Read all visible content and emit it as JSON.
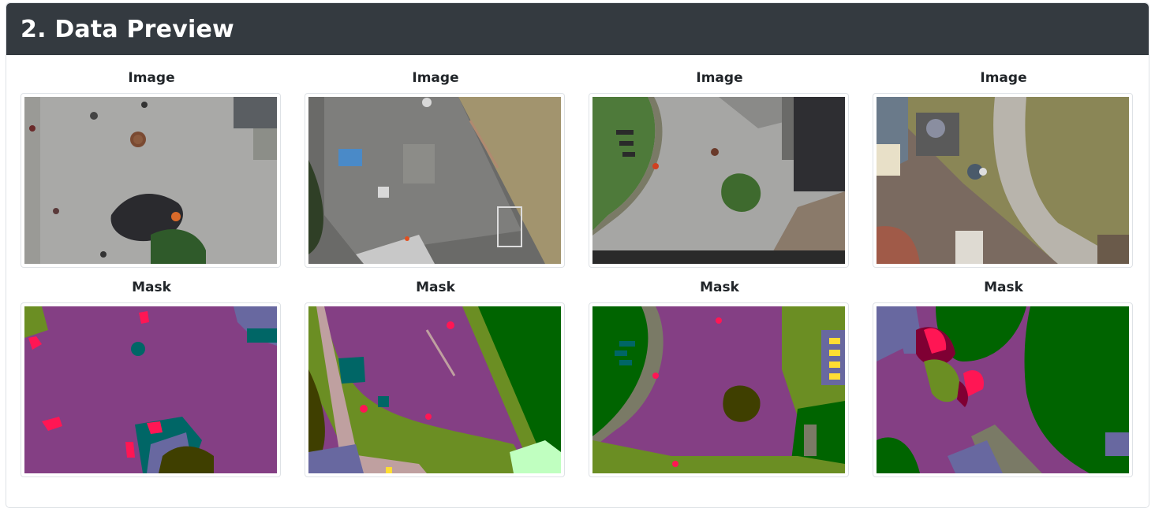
{
  "section": {
    "title": "2. Data Preview"
  },
  "labels": {
    "image": "Image",
    "mask": "Mask"
  },
  "mask_palette": {
    "paved": "#843f84",
    "grass": "#6b8e23",
    "vegetation": "#006400",
    "person": "#ff1654",
    "obstacle": "#006666",
    "roof": "#6868a0",
    "dirt": "#7a7a66",
    "tree": "#3f3f00",
    "gravel": "#bfa0a0",
    "bicycle": "#7f0033",
    "window": "#ffdd33",
    "fence": "#c0ffc0"
  }
}
